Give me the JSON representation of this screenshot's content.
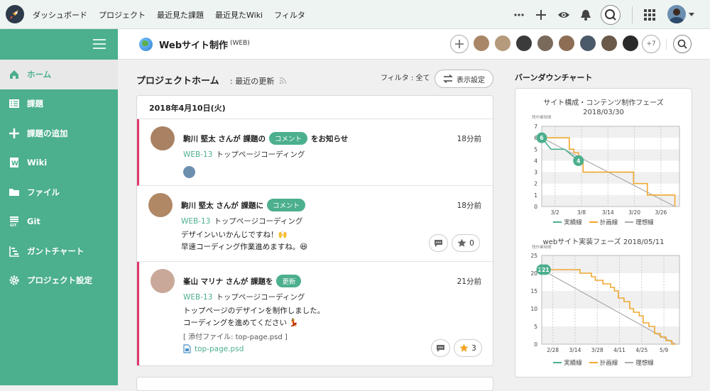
{
  "topnav": {
    "items": [
      "ダッシュボード",
      "プロジェクト",
      "最近見た課題",
      "最近見たWiki",
      "フィルタ"
    ]
  },
  "topright": {
    "icons": [
      "more-icon",
      "plus-icon",
      "eye-icon",
      "bell-icon",
      "search-icon",
      "apps-grid-icon",
      "avatar",
      "chevron-down-icon"
    ]
  },
  "sidebar": {
    "items": [
      {
        "label": "ホーム",
        "icon": "home-icon",
        "active": true
      },
      {
        "label": "課題",
        "icon": "list-icon"
      },
      {
        "label": "課題の追加",
        "icon": "plus-icon"
      },
      {
        "label": "Wiki",
        "icon": "wiki-icon"
      },
      {
        "label": "ファイル",
        "icon": "folder-icon"
      },
      {
        "label": "Git",
        "icon": "git-icon"
      },
      {
        "label": "ガントチャート",
        "icon": "gantt-icon"
      },
      {
        "label": "プロジェクト設定",
        "icon": "gear-icon"
      }
    ]
  },
  "project": {
    "name": "Webサイト制作",
    "key": "(WEB)",
    "members_more": "+7"
  },
  "main": {
    "title": "プロジェクトホーム",
    "subtitle": ": 最近の更新",
    "filter": "フィルタ : 全て",
    "settings_button": "表示設定",
    "date": "2018年4月10日(火)",
    "entries": [
      {
        "user": "駒川 堅太 さんが 課題の",
        "badge": "コメント",
        "suffix": "をお知らせ",
        "time": "18分前",
        "issue_key": "WEB-13",
        "issue_title": "トップページコーディング"
      },
      {
        "user": "駒川 堅太 さんが 課題に",
        "badge": "コメント",
        "suffix": "",
        "time": "18分前",
        "issue_key": "WEB-13",
        "issue_title": "トップページコーディング",
        "lines": [
          "デザインいいかんじですね！🙌",
          "早速コーディング作業進めますね。😆"
        ],
        "star_count": "0"
      },
      {
        "user": "峯山 マリナ さんが 課題を",
        "badge": "更新",
        "suffix": "",
        "time": "21分前",
        "issue_key": "WEB-13",
        "issue_title": "トップページコーディング",
        "lines": [
          "トップページのデザインを制作しました。",
          "コーディングを進めてください 💃"
        ],
        "attachment_note": "[ 添付ファイル: top-page.psd ]",
        "attachment_file": "top-page.psd",
        "star_count": "3"
      }
    ]
  },
  "burndown": {
    "title": "バーンダウンチャート",
    "legend": [
      "実績線",
      "計画線",
      "理想線"
    ],
    "colors": {
      "actual": "#4caf8e",
      "plan": "#f0a830",
      "ideal": "#aaaaaa"
    }
  },
  "chart_data": [
    {
      "type": "line",
      "title": "サイト構成・コンテンツ制作フェーズ",
      "subtitle": "2018/03/30",
      "ylabel": "残作業時間",
      "ylim": [
        0,
        7
      ],
      "yticks": [
        0,
        1,
        2,
        3,
        4,
        5,
        6,
        7
      ],
      "xticks": [
        "3/2",
        "3/8",
        "3/14",
        "3/20",
        "3/26"
      ],
      "xlim": [
        0,
        30
      ],
      "series": [
        {
          "name": "実績線",
          "x": [
            0,
            2,
            5,
            8
          ],
          "y": [
            6,
            5,
            5,
            4
          ],
          "markers": [
            {
              "x": 0,
              "y": 6,
              "label": "6"
            },
            {
              "x": 8,
              "y": 4,
              "label": "4"
            }
          ]
        },
        {
          "name": "計画線",
          "x": [
            0,
            2,
            2,
            6,
            6,
            7,
            7,
            8,
            8,
            9,
            9,
            20,
            20,
            23,
            23,
            25,
            25,
            29,
            29
          ],
          "y": [
            6,
            6,
            6,
            6,
            5,
            5,
            4.7,
            4.7,
            4,
            4,
            3,
            3,
            2,
            2,
            1,
            1,
            1,
            1,
            0
          ]
        },
        {
          "name": "理想線",
          "x": [
            0,
            29
          ],
          "y": [
            6,
            0
          ]
        }
      ]
    },
    {
      "type": "line",
      "title": "webサイト実装フェーズ",
      "subtitle": "2018/05/11",
      "ylabel": "残作業時間",
      "ylim": [
        0,
        25
      ],
      "yticks": [
        0,
        5,
        10,
        15,
        20,
        25
      ],
      "xticks": [
        "2/28",
        "3/14",
        "3/28",
        "4/11",
        "4/25",
        "5/9"
      ],
      "xlim": [
        0,
        72
      ],
      "series": [
        {
          "name": "実績線",
          "x": [
            0,
            2
          ],
          "y": [
            21,
            21
          ],
          "markers": [
            {
              "x": 0,
              "y": 21,
              "label": "21"
            },
            {
              "x": 2,
              "y": 21,
              "label": "21"
            }
          ]
        },
        {
          "name": "計画線",
          "x": [
            0,
            10,
            10,
            20,
            20,
            26,
            26,
            28,
            28,
            32,
            32,
            36,
            36,
            38,
            38,
            40,
            40,
            43,
            43,
            46,
            46,
            48,
            48,
            51,
            51,
            53,
            53,
            56,
            56,
            59,
            59,
            62,
            62,
            65,
            65,
            68,
            68,
            70
          ],
          "y": [
            21,
            21,
            21,
            21,
            20,
            20,
            19,
            19,
            18,
            18,
            17,
            17,
            16,
            16,
            15,
            15,
            13,
            13,
            12,
            12,
            10,
            10,
            9,
            9,
            8,
            8,
            6,
            6,
            5,
            5,
            3,
            3,
            2,
            2,
            1,
            1,
            0,
            0
          ]
        },
        {
          "name": "理想線",
          "x": [
            0,
            70
          ],
          "y": [
            21,
            0
          ]
        }
      ]
    }
  ]
}
